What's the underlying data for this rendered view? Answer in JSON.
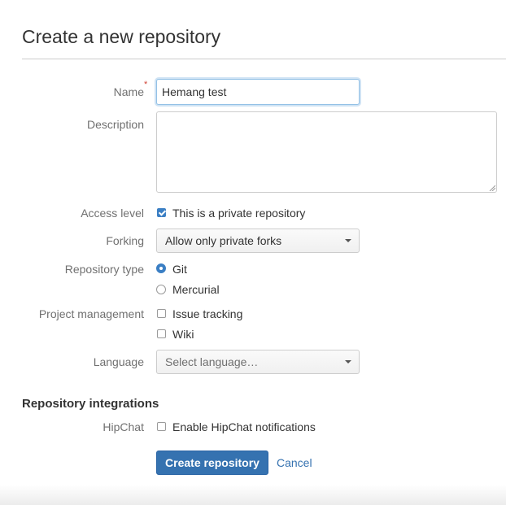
{
  "page": {
    "title": "Create a new repository"
  },
  "form": {
    "name": {
      "label": "Name",
      "required_marker": "*",
      "value": "Hemang test"
    },
    "description": {
      "label": "Description",
      "value": ""
    },
    "access_level": {
      "label": "Access level",
      "option_label": "This is a private repository",
      "checked": true
    },
    "forking": {
      "label": "Forking",
      "selected": "Allow only private forks"
    },
    "repository_type": {
      "label": "Repository type",
      "options": [
        {
          "label": "Git",
          "checked": true
        },
        {
          "label": "Mercurial",
          "checked": false
        }
      ]
    },
    "project_management": {
      "label": "Project management",
      "options": [
        {
          "label": "Issue tracking",
          "checked": false
        },
        {
          "label": "Wiki",
          "checked": false
        }
      ]
    },
    "language": {
      "label": "Language",
      "placeholder": "Select language…"
    }
  },
  "integrations": {
    "heading": "Repository integrations",
    "hipchat": {
      "label": "HipChat",
      "option_label": "Enable HipChat notifications",
      "checked": false
    }
  },
  "actions": {
    "submit_label": "Create repository",
    "cancel_label": "Cancel"
  },
  "colors": {
    "accent": "#3572b0",
    "required": "#d04437",
    "label": "#707070"
  }
}
